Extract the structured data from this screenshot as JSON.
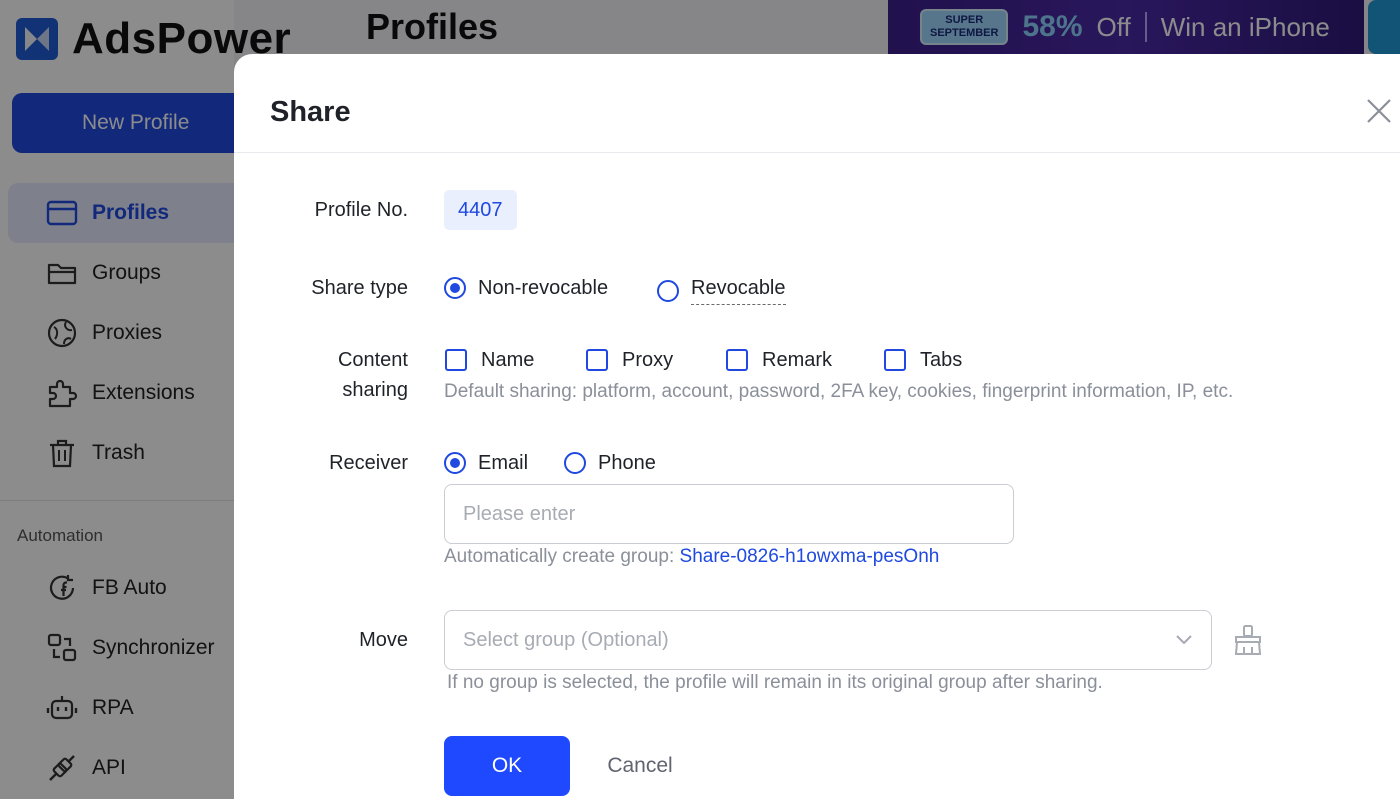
{
  "app": {
    "brand": "AdsPower",
    "page_title": "Profiles",
    "new_profile_label": "New Profile",
    "nav": [
      {
        "label": "Profiles",
        "icon": "browser-window-icon",
        "active": true
      },
      {
        "label": "Groups",
        "icon": "folder-icon"
      },
      {
        "label": "Proxies",
        "icon": "globe-icon"
      },
      {
        "label": "Extensions",
        "icon": "puzzle-icon"
      },
      {
        "label": "Trash",
        "icon": "trash-icon"
      }
    ],
    "automation_label": "Automation",
    "automation_nav": [
      {
        "label": "FB Auto",
        "icon": "facebook-sync-icon"
      },
      {
        "label": "Synchronizer",
        "icon": "synchronizer-icon"
      },
      {
        "label": "RPA",
        "icon": "robot-icon"
      },
      {
        "label": "API",
        "icon": "plug-icon"
      }
    ],
    "promo": {
      "badge_line1": "SUPER",
      "badge_line2": "SEPTEMBER",
      "percent": "58%",
      "off": "Off",
      "win": "Win an iPhone"
    }
  },
  "dialog": {
    "title": "Share",
    "profile_no_label": "Profile No.",
    "profile_no_value": "4407",
    "share_type_label": "Share type",
    "share_type_options": [
      {
        "label": "Non-revocable",
        "selected": true
      },
      {
        "label": "Revocable",
        "selected": false
      }
    ],
    "content_sharing_label_line1": "Content",
    "content_sharing_label_line2": "sharing",
    "content_options": [
      {
        "label": "Name",
        "checked": false
      },
      {
        "label": "Proxy",
        "checked": false
      },
      {
        "label": "Remark",
        "checked": false
      },
      {
        "label": "Tabs",
        "checked": false
      }
    ],
    "content_hint": "Default sharing: platform, account, password, 2FA key, cookies, fingerprint information, IP, etc.",
    "receiver_label": "Receiver",
    "receiver_options": [
      {
        "label": "Email",
        "selected": true
      },
      {
        "label": "Phone",
        "selected": false
      }
    ],
    "receiver_input_value": "",
    "receiver_placeholder": "Please enter",
    "auto_group_prefix": "Automatically create group: ",
    "auto_group_name": "Share-0826-h1owxma-pesOnh",
    "move_label": "Move",
    "move_placeholder": "Select group (Optional)",
    "move_hint": "If no group is selected, the profile will remain in its original group after sharing.",
    "ok_label": "OK",
    "cancel_label": "Cancel"
  },
  "colors": {
    "primary": "#1f49e0",
    "button": "#1f49ff",
    "hint": "#8a8f99"
  }
}
